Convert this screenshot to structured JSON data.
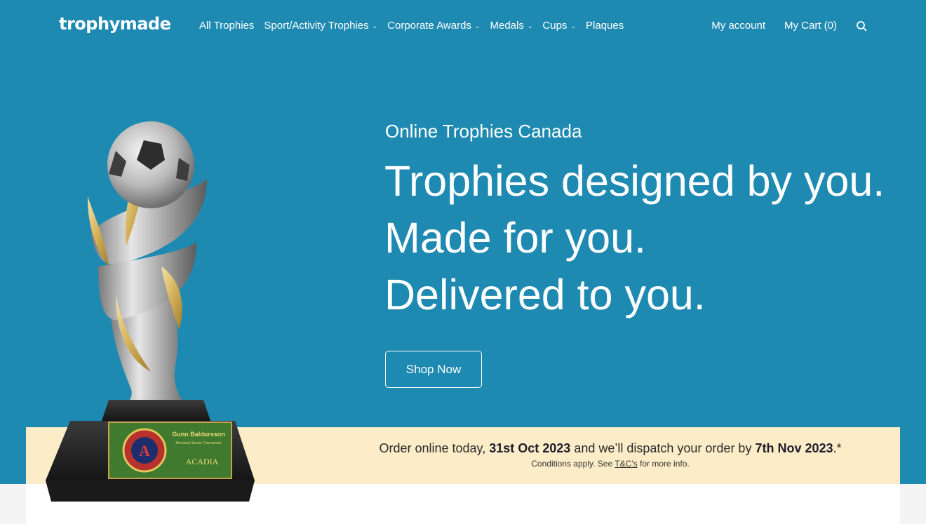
{
  "brand": {
    "logo_text": "trophymade"
  },
  "nav": {
    "items": [
      {
        "label": "All Trophies",
        "has_dropdown": false
      },
      {
        "label": "Sport/Activity Trophies",
        "has_dropdown": true
      },
      {
        "label": "Corporate Awards",
        "has_dropdown": true
      },
      {
        "label": "Medals",
        "has_dropdown": true
      },
      {
        "label": "Cups",
        "has_dropdown": true
      },
      {
        "label": "Plaques",
        "has_dropdown": false
      }
    ],
    "dropdown_icon": "chevron-down-icon"
  },
  "header_right": {
    "account_label": "My account",
    "cart_label": "My Cart (0)",
    "search_icon": "search-icon"
  },
  "hero": {
    "kicker": "Online Trophies Canada",
    "headline_lines": [
      "Trophies designed by you.",
      "Made for you.",
      "Delivered to you."
    ],
    "cta_label": "Shop Now"
  },
  "trophy_plaque": {
    "name": "Gunn Baldursson",
    "event": "Memorial Soccer Tournament",
    "org": "ACADIA",
    "badge_letter": "A"
  },
  "dispatch": {
    "prefix": "Order online today, ",
    "order_date": "31st Oct 2023",
    "middle": " and we’ll dispatch your order by ",
    "dispatch_date": "7th Nov 2023",
    "suffix": ".*",
    "conditions_prefix": "Conditions apply. See ",
    "conditions_link": "T&C’s",
    "conditions_suffix": " for more info."
  },
  "colors": {
    "hero_bg": "#1e8ab2",
    "banner_bg": "#fdecc8",
    "text_on_hero": "#ffffff"
  }
}
